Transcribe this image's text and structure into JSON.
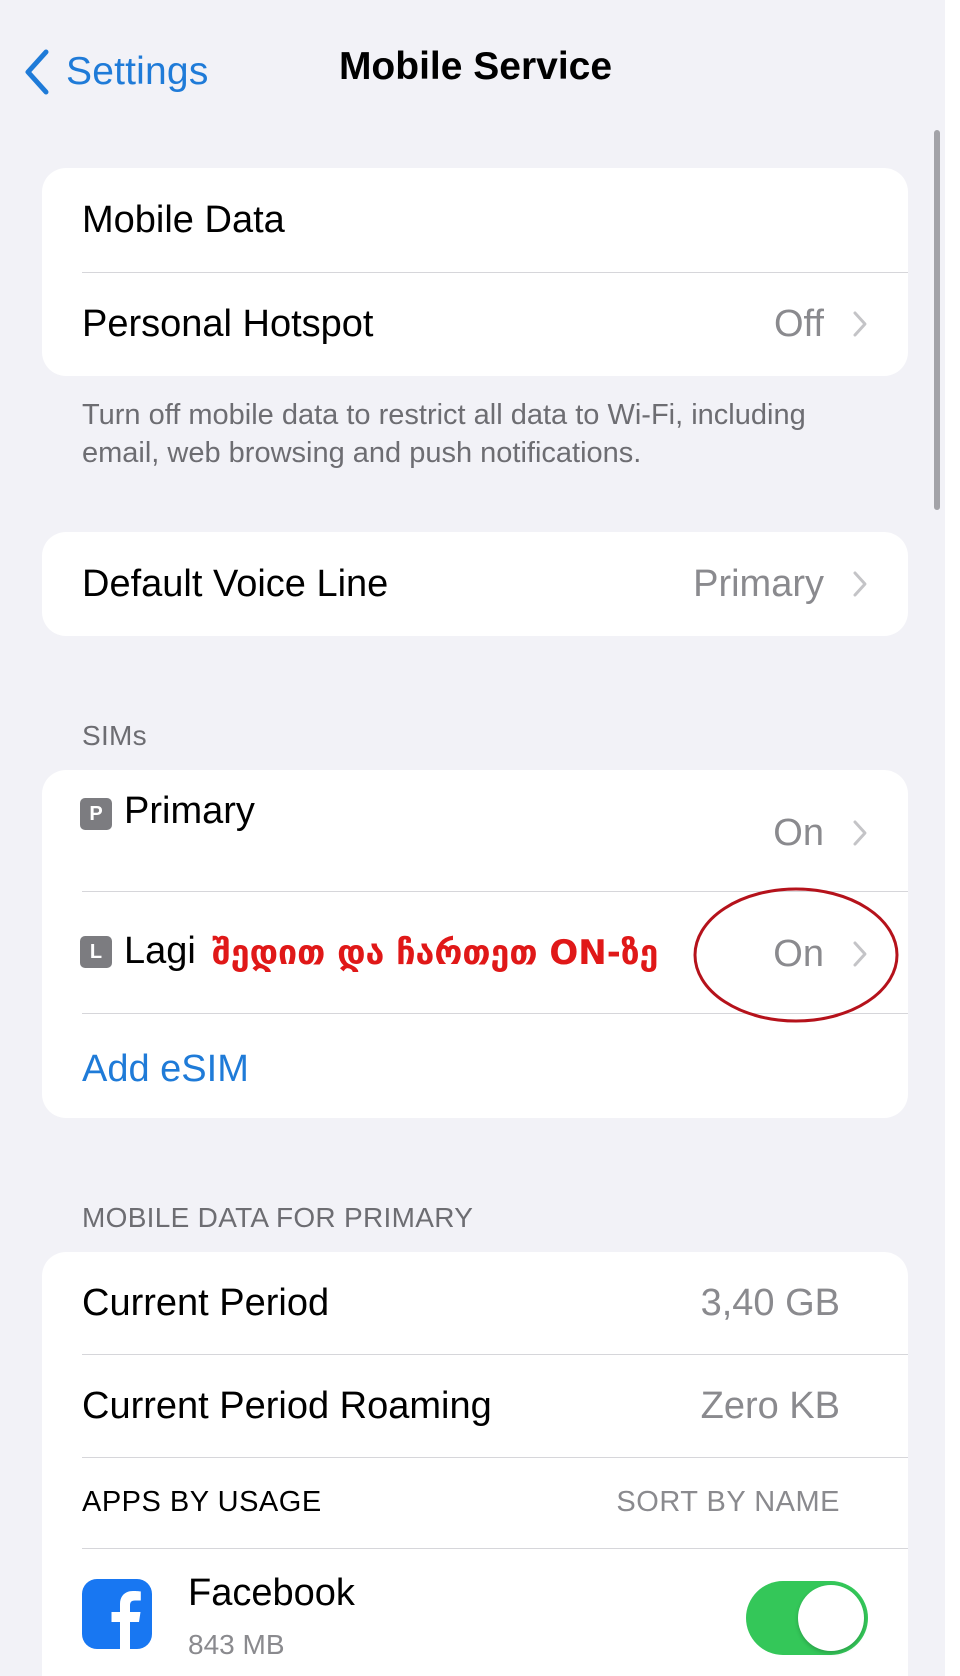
{
  "nav": {
    "back_label": "Settings",
    "title": "Mobile Service"
  },
  "group1": {
    "mobile_data_label": "Mobile Data",
    "hotspot_label": "Personal Hotspot",
    "hotspot_value": "Off",
    "footnote": "Turn off mobile data to restrict all data to Wi-Fi, including email, web browsing and push notifications."
  },
  "voice": {
    "label": "Default Voice Line",
    "value": "Primary"
  },
  "sims": {
    "header": "SIMs",
    "primary": {
      "badge": "P",
      "label": "Primary",
      "value": "On"
    },
    "lagi": {
      "badge": "L",
      "label": "Lagi",
      "value": "On"
    },
    "annotation": "შედით და ჩართეთ ON-ზე",
    "add_esim": "Add eSIM"
  },
  "mobile_data_primary": {
    "header": "MOBILE DATA FOR PRIMARY",
    "current_period_label": "Current Period",
    "current_period_value": "3,40 GB",
    "roaming_label": "Current Period Roaming",
    "roaming_value": "Zero KB",
    "apps_header": "APPS BY USAGE",
    "sort_label": "SORT BY NAME"
  },
  "apps": [
    {
      "name": "Facebook",
      "usage": "843 MB",
      "icon": "facebook-icon",
      "enabled": true
    }
  ],
  "colors": {
    "accent": "#1f7bd8",
    "toggle_on": "#34c759",
    "annotation": "#e01818",
    "background": "#f2f2f7"
  }
}
